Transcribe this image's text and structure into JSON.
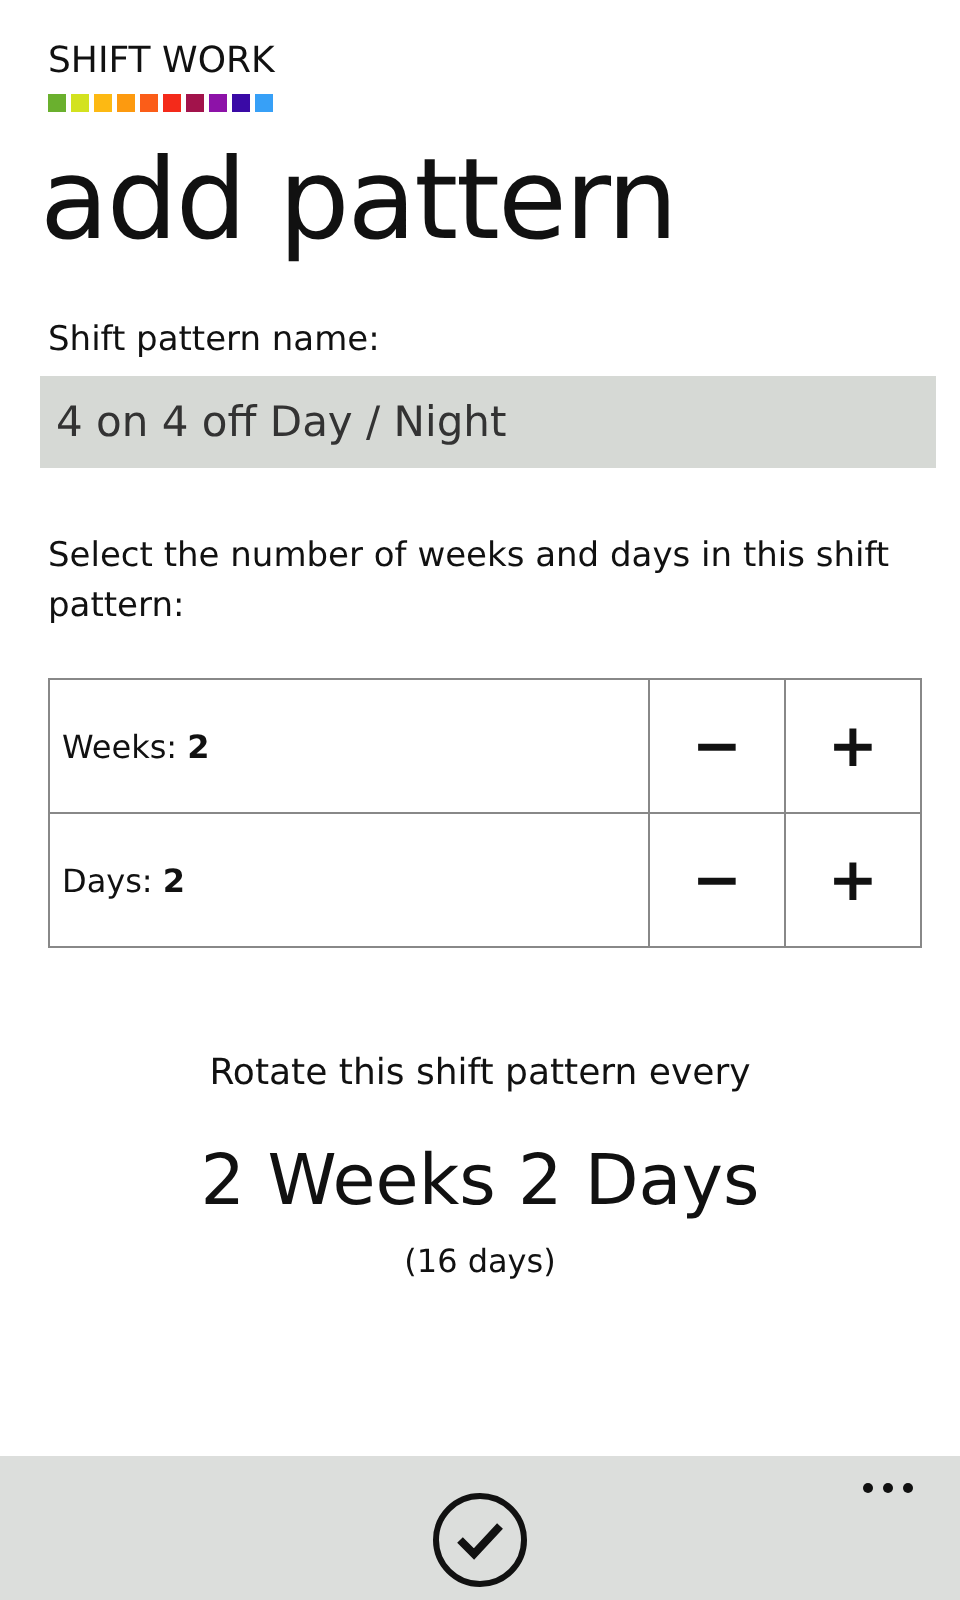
{
  "app_title": "SHIFT WORK",
  "page_title": "add pattern",
  "name_field": {
    "label": "Shift pattern name:",
    "value": "4 on 4 off Day / Night"
  },
  "instruction": "Select the number of weeks and days in this shift pattern:",
  "counters": [
    {
      "label": "Weeks: **2**",
      "minus": "−",
      "plus": "+"
    },
    {
      "label": "Days: **2**",
      "minus": "−",
      "plus": "+"
    }
  ],
  "rotate_caption": "Rotate this shift pattern every",
  "rotate_value": "2 Weeks 2 Days",
  "rotate_total": "(16 days)"
}
